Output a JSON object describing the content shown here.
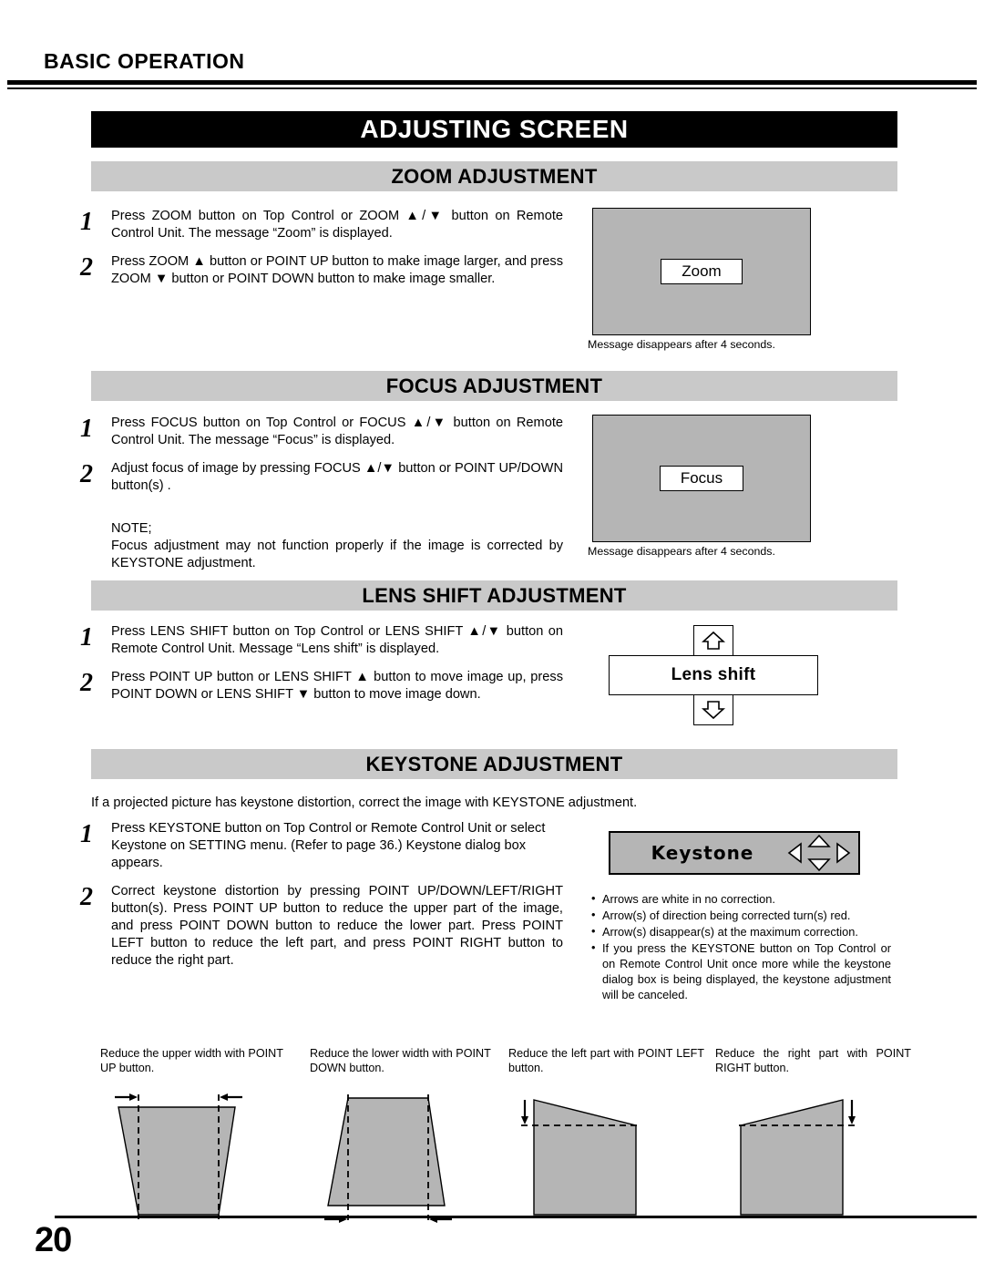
{
  "running_head": "BASIC OPERATION",
  "main_title": "ADJUSTING SCREEN",
  "page_number": "20",
  "colors": {
    "osd_gray": "#b5b5b5",
    "bar_gray": "#c9c9c9",
    "ink": "#000000"
  },
  "sections": {
    "zoom": {
      "header": "ZOOM ADJUSTMENT",
      "steps": [
        {
          "num": "1",
          "text": "Press ZOOM button on Top Control or ZOOM ▲/▼ button on Remote Control Unit.  The message “Zoom” is displayed."
        },
        {
          "num": "2",
          "text": "Press ZOOM ▲ button or POINT UP button to make image larger, and press ZOOM ▼ button or POINT DOWN button to make image smaller."
        }
      ],
      "osd_label": "Zoom",
      "osd_caption": "Message disappears after 4 seconds."
    },
    "focus": {
      "header": "FOCUS ADJUSTMENT",
      "steps": [
        {
          "num": "1",
          "text": "Press FOCUS button on Top Control or FOCUS ▲/▼ button on Remote Control Unit.  The message “Focus” is displayed."
        },
        {
          "num": "2",
          "text": "Adjust focus of image by pressing FOCUS ▲/▼  button or POINT UP/DOWN button(s) ."
        }
      ],
      "note_label": "NOTE;",
      "note_text": "Focus adjustment may not function properly if the image is corrected by KEYSTONE adjustment.",
      "osd_label": "Focus",
      "osd_caption": "Message disappears after 4 seconds."
    },
    "lens_shift": {
      "header": "LENS SHIFT ADJUSTMENT",
      "steps": [
        {
          "num": "1",
          "text": "Press LENS SHIFT button on Top Control or LENS SHIFT ▲/▼ button on Remote Control Unit. Message “Lens shift” is displayed."
        },
        {
          "num": "2",
          "text": "Press POINT UP button or LENS SHIFT ▲ button to move image up, press POINT DOWN or LENS SHIFT ▼ button to move image down."
        }
      ],
      "osd_label": "Lens shift"
    },
    "keystone": {
      "header": "KEYSTONE ADJUSTMENT",
      "intro": "If a projected picture has keystone distortion, correct the image with KEYSTONE adjustment.",
      "steps": [
        {
          "num": "1",
          "text": "Press KEYSTONE button on Top Control or Remote Control Unit or select Keystone on SETTING menu.  (Refer to page 36.) Keystone dialog box appears."
        },
        {
          "num": "2",
          "text": "Correct keystone distortion by pressing POINT UP/DOWN/LEFT/RIGHT button(s).  Press POINT UP button to reduce the upper part of the image, and press POINT DOWN button to reduce the lower part.  Press POINT LEFT button to reduce the left part, and press POINT RIGHT button to reduce the right part."
        }
      ],
      "dialog_label": "Keystone",
      "bullets": [
        "Arrows are white in no correction.",
        "Arrow(s) of direction being corrected turn(s) red.",
        "Arrow(s) disappear(s) at the maximum correction.",
        "If you press the KEYSTONE button on Top Control or on Remote Control Unit once more while the keystone dialog box is being displayed, the keystone adjustment will be canceled."
      ],
      "figures": [
        {
          "caption": "Reduce the upper width with POINT UP button."
        },
        {
          "caption": "Reduce the lower width with POINT DOWN button."
        },
        {
          "caption": "Reduce the left part with POINT LEFT button."
        },
        {
          "caption": "Reduce the right part with POINT RIGHT button."
        }
      ]
    }
  }
}
